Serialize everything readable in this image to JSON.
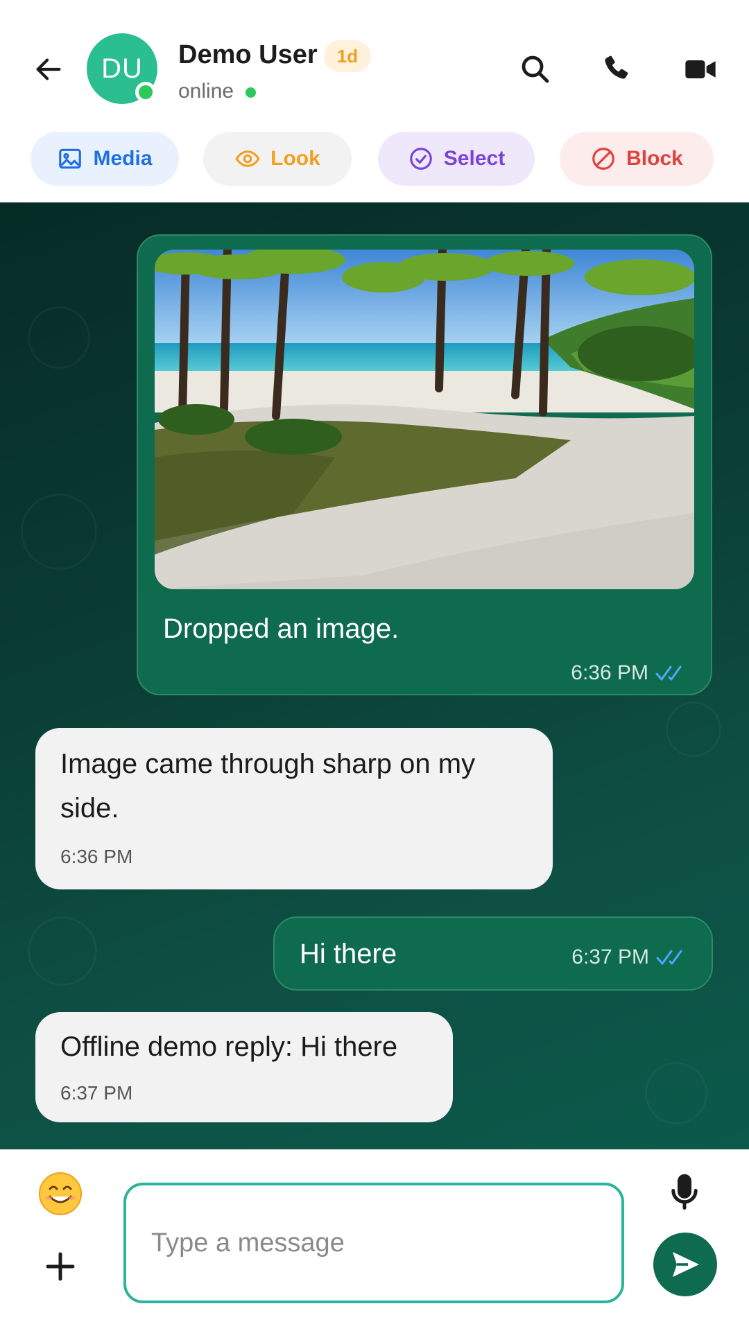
{
  "header": {
    "avatar_initials": "DU",
    "name": "Demo User",
    "age_badge": "1d",
    "status": "online"
  },
  "actions": {
    "media": "Media",
    "look": "Look",
    "select": "Select",
    "block": "Block"
  },
  "messages": {
    "m1": {
      "direction": "outgoing",
      "caption": "Dropped an image.",
      "time": "6:36 PM",
      "read": true,
      "image_description_icon": "beach-photo"
    },
    "m2": {
      "direction": "incoming",
      "line1": "Image came through sharp on my",
      "line2": "side.",
      "time": "6:36 PM"
    },
    "m3": {
      "direction": "outgoing",
      "text": "Hi there",
      "time": "6:37 PM",
      "read": true
    },
    "m4": {
      "direction": "incoming",
      "text": "Offline demo reply: Hi there",
      "time": "6:37 PM"
    }
  },
  "composer": {
    "placeholder": "Type a message",
    "value": ""
  },
  "colors": {
    "accent": "#0f6b4e",
    "avatar": "#2bbf8f",
    "online": "#2ec95c",
    "read_ticks": "#4aa8ff",
    "media_chip": "#1f6fe0",
    "look_chip": "#f0a020",
    "select_chip": "#7a45d6",
    "block_chip": "#e2403c"
  }
}
